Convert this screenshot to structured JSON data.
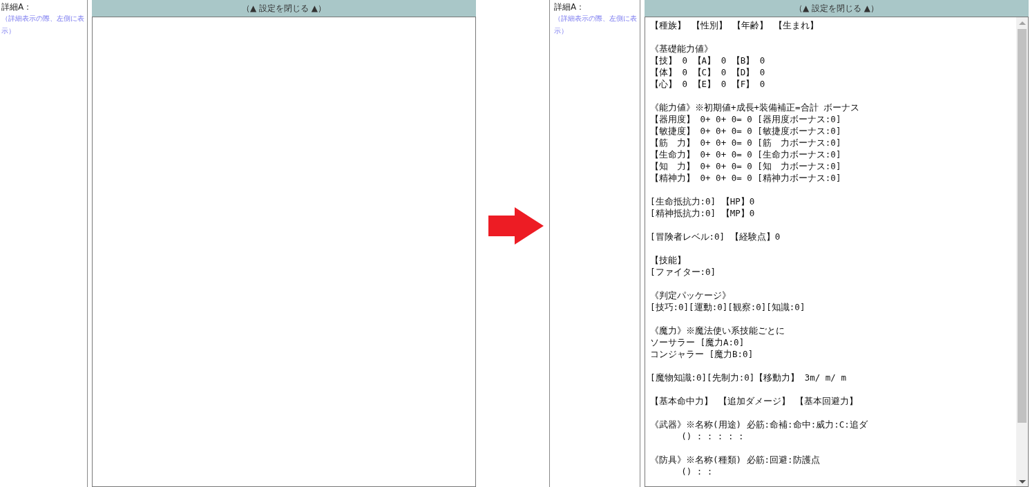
{
  "panels": [
    {
      "label": "詳細A：",
      "hint": "（詳細表示の際、左側に表示）",
      "toggle": "（▲ 設定を閉じる ▲）"
    },
    {
      "label": "詳細A：",
      "hint": "（詳細表示の際、左側に表示）",
      "toggle": "（▲ 設定を閉じる ▲）",
      "paragraphs": [
        [
          "【種族】 【性別】 【年齢】 【生まれ】"
        ],
        [
          "《基礎能力値》",
          "【技】 0 【A】 0 【B】 0",
          "【体】 0 【C】 0 【D】 0",
          "【心】 0 【E】 0 【F】 0"
        ],
        [
          "《能力値》※初期値+成長+装備補正=合計 ボーナス",
          "【器用度】 0+ 0+ 0= 0 [器用度ボーナス:0]",
          "【敏捷度】 0+ 0+ 0= 0 [敏捷度ボーナス:0]",
          "【筋　力】 0+ 0+ 0= 0 [筋　力ボーナス:0]",
          "【生命力】 0+ 0+ 0= 0 [生命力ボーナス:0]",
          "【知　力】 0+ 0+ 0= 0 [知　力ボーナス:0]",
          "【精神力】 0+ 0+ 0= 0 [精神力ボーナス:0]"
        ],
        [
          "[生命抵抗力:0] 【HP】0",
          "[精神抵抗力:0] 【MP】0"
        ],
        [
          "[冒険者レベル:0] 【経験点】0"
        ],
        [
          "【技能】",
          "[ファイター:0]"
        ],
        [
          "《判定パッケージ》",
          "[技巧:0][運動:0][観察:0][知識:0]"
        ],
        [
          "《魔力》※魔法使い系技能ごとに",
          "ソーサラー [魔力A:0]",
          "コンジャラー [魔力B:0]"
        ],
        [
          "[魔物知識:0][先制力:0]【移動力】 3m/ m/ m"
        ],
        [
          "【基本命中力】 【追加ダメージ】 【基本回避力】"
        ],
        [
          "《武器》※名称(用途) 必筋:命補:命中:威力:C:追ダ",
          "      () : : : : :"
        ],
        [
          "《防具》※名称(種類) 必筋:回避:防護点",
          "      () : :"
        ]
      ]
    }
  ]
}
